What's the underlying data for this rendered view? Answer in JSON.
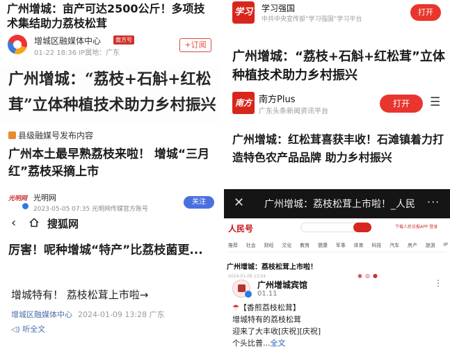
{
  "panel1": {
    "title": "广州增城：亩产可达2500公斤！多项技术集结助力荔枝松茸",
    "source": "增城区融媒体中心",
    "badge": "南方号",
    "meta": "01-22 18:36  IP属地：广东",
    "subscribe_label": "+订阅"
  },
  "panel2": {
    "headline": "广州增城：“荔枝+石斛+红松茸”立体种植技术助力乡村振兴"
  },
  "panel3": {
    "tag": "县级融媒号发布内容",
    "title": "广州本土最早熟荔枝来啦！ 增城“三月红”荔枝采摘上市"
  },
  "panel4": {
    "logo_text": "光明网",
    "name": "光明网",
    "meta": "2023-05-05 07:35   光明网传媒官方账号",
    "follow_label": "关注"
  },
  "panel5": {
    "back_glyph": "‹",
    "site": "搜狐网",
    "title": "厉害！呢种增城“特产”比荔枝菌更...",
    "link": "增城特有！ 荔枝松茸上市啦→",
    "org": "增城区融媒体中心",
    "meta": "2024-01-09 13:28  广东",
    "listen": "听全文"
  },
  "panel6": {
    "logo_text": "学习",
    "name": "学习强国",
    "desc": "中共中央宣传部“学习强国”学习平台",
    "open_label": "打开"
  },
  "panel7": {
    "title": "广州增城：“荔枝+石斛+红松茸”立体种植技术助力乡村振兴"
  },
  "panel8": {
    "logo_text": "南方",
    "name": "南方Plus",
    "desc": "广东头条新闻资讯平台",
    "open_label": "打开",
    "menu_glyph": "☰"
  },
  "panel9": {
    "title": "广州增城：红松茸喜获丰收！石滩镇着力打造特色农产品品牌 助力乡村振兴"
  },
  "panel10": {
    "close_glyph": "✕",
    "title": "广州增城：荔枝松茸上市啦！_人民",
    "more_glyph": "···"
  },
  "panel11": {
    "brand": "人民号",
    "top_links": "下载人民日报APP   登录",
    "nav": [
      "推荐",
      "社会",
      "财经",
      "文化",
      "教育",
      "健康",
      "军事",
      "体育",
      "科技",
      "汽车",
      "房产",
      "旅游",
      "IP"
    ],
    "page_title": "广州增城：荔枝松茸上市啦！",
    "page_meta": "2024-01-09 13:24",
    "account_name": "广州增城宾馆",
    "account_date": "01.11",
    "kebab": "⋮",
    "post_line1": "【香煎荔枝松茸】",
    "post_line2": "增城特有的荔枝松茸",
    "post_line3": "迎来了大丰收[庆祝][庆祝]",
    "post_line4": "个头比普...",
    "post_more": "全文"
  },
  "colors": {
    "accent_red": "#e8352d",
    "link_blue": "#4a6ea8",
    "follow_blue": "#4a70e0"
  }
}
